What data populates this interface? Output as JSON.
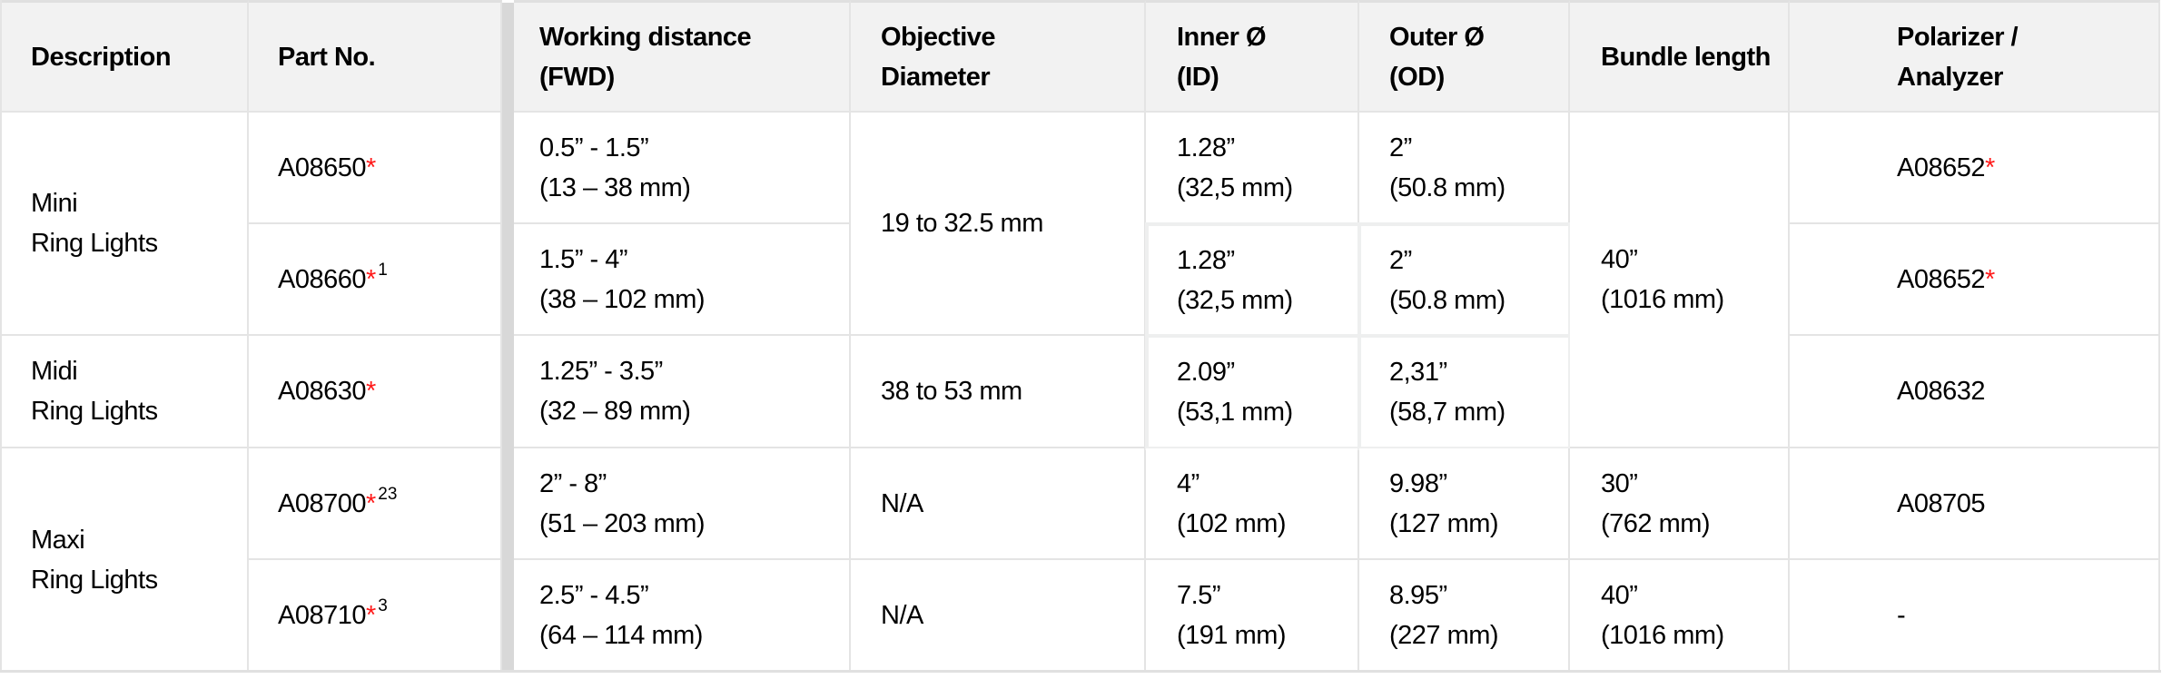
{
  "header": {
    "description": "Description",
    "part_no": "Part No.",
    "working_distance": "Working distance\n(FWD)",
    "objective_diameter": "Objective\nDiameter",
    "inner_diameter": "Inner Ø\n(ID)",
    "outer_diameter": "Outer Ø\n(OD)",
    "bundle_length": "Bundle length",
    "polarizer_analyzer": "Polarizer /\nAnalyzer"
  },
  "groups": [
    {
      "description": "Mini\nRing Lights"
    },
    {
      "description": "Midi\nRing Lights"
    },
    {
      "description": "Maxi\nRing Lights"
    }
  ],
  "rows": [
    {
      "part_no": "A08650",
      "star": "*",
      "footnote": "",
      "working_distance": "0.5” - 1.5”\n(13 – 38 mm)",
      "inner": "1.28”\n(32,5 mm)",
      "outer": "2”\n(50.8 mm)",
      "polarizer": "A08652",
      "polarizer_star": "*"
    },
    {
      "part_no": "A08660",
      "star": "*",
      "footnote": "1",
      "working_distance": "1.5” - 4”\n(38 – 102 mm)",
      "inner": "1.28”\n(32,5 mm)",
      "outer": "2”\n(50.8 mm)",
      "polarizer": "A08652",
      "polarizer_star": "*"
    },
    {
      "part_no": "A08630",
      "star": "*",
      "footnote": "",
      "working_distance": "1.25” - 3.5”\n(32 – 89 mm)",
      "inner": "2.09”\n(53,1 mm)",
      "outer": "2,31”\n(58,7 mm)",
      "polarizer": "A08632",
      "polarizer_star": ""
    },
    {
      "part_no": "A08700",
      "star": "*",
      "footnote": "23",
      "working_distance": "2” - 8”\n(51 – 203 mm)",
      "inner": "4”\n(102 mm)",
      "outer": "9.98”\n(127 mm)",
      "polarizer": "A08705",
      "polarizer_star": ""
    },
    {
      "part_no": "A08710",
      "star": "*",
      "footnote": "3",
      "working_distance": "2.5” - 4.5”\n(64 – 114 mm)",
      "inner": "7.5”\n(191 mm)",
      "outer": "8.95”\n(227 mm)",
      "polarizer": "-",
      "polarizer_star": ""
    }
  ],
  "objective": {
    "mini": "19 to 32.5 mm",
    "midi": "38 to 53 mm",
    "maxi_1": "N/A",
    "maxi_2": "N/A"
  },
  "bundle": {
    "mini_midi": "40”\n(1016 mm)",
    "maxi_1": "30”\n(762 mm)",
    "maxi_2": "40”\n(1016 mm)"
  },
  "colors": {
    "asterisk": "#ff1a1a",
    "header_bg": "#f2f2f2",
    "grid": "#e4e4e4"
  }
}
